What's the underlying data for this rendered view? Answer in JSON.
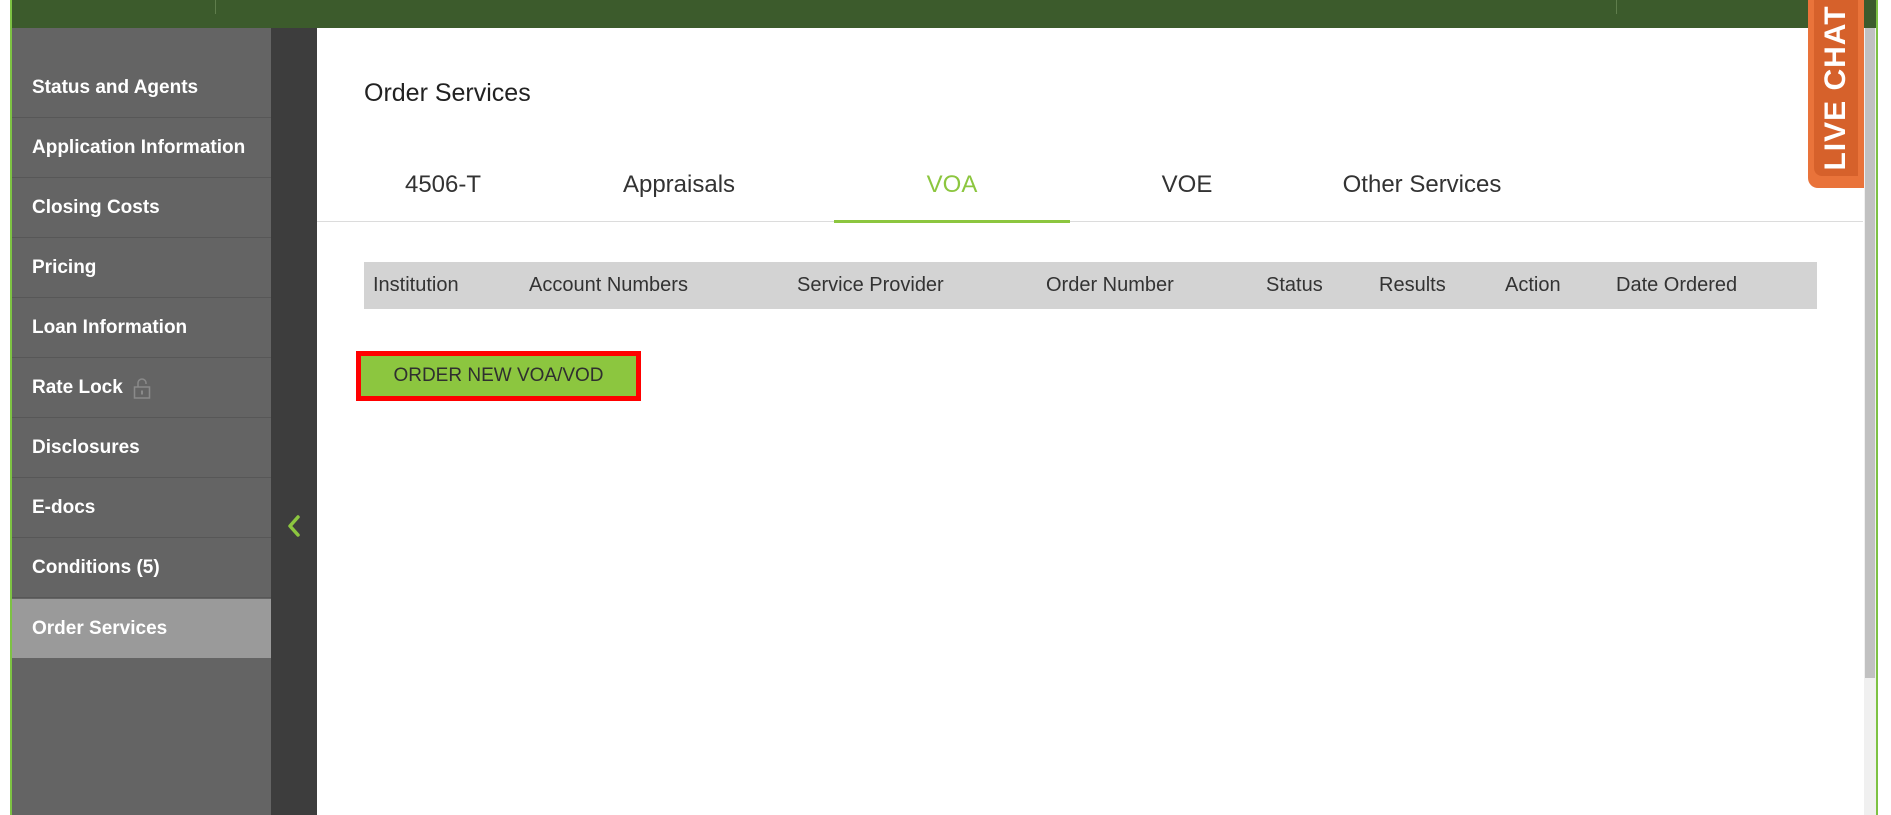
{
  "page": {
    "title": "Order Services"
  },
  "sidebar": {
    "items": [
      {
        "label": "Status and Agents"
      },
      {
        "label": "Application Information"
      },
      {
        "label": "Closing Costs"
      },
      {
        "label": "Pricing"
      },
      {
        "label": "Loan Information"
      },
      {
        "label": "Rate Lock"
      },
      {
        "label": "Disclosures"
      },
      {
        "label": "E-docs"
      },
      {
        "label": "Conditions (5)"
      },
      {
        "label": "Order Services"
      }
    ],
    "active_item": "Order Services"
  },
  "tabs": [
    {
      "label": "4506-T"
    },
    {
      "label": "Appraisals"
    },
    {
      "label": "VOA"
    },
    {
      "label": "VOE"
    },
    {
      "label": "Other Services"
    }
  ],
  "active_tab": "VOA",
  "table": {
    "columns": [
      "Institution",
      "Account Numbers",
      "Service Provider",
      "Order Number",
      "Status",
      "Results",
      "Action",
      "Date Ordered"
    ]
  },
  "order_button": {
    "label": "ORDER NEW VOA/VOD"
  },
  "live_chat": {
    "label": "LIVE CHAT"
  },
  "icons": {
    "rate_lock": "unlock-icon",
    "collapse": "chevron-left-icon"
  },
  "colors": {
    "accent_green": "#8cc63f",
    "top_bar": "#3c5b2c",
    "sidebar_bg": "#646464",
    "sidebar_active": "#9a9a9a",
    "highlight_outline": "#ff0000",
    "live_chat": "#e9733a"
  }
}
